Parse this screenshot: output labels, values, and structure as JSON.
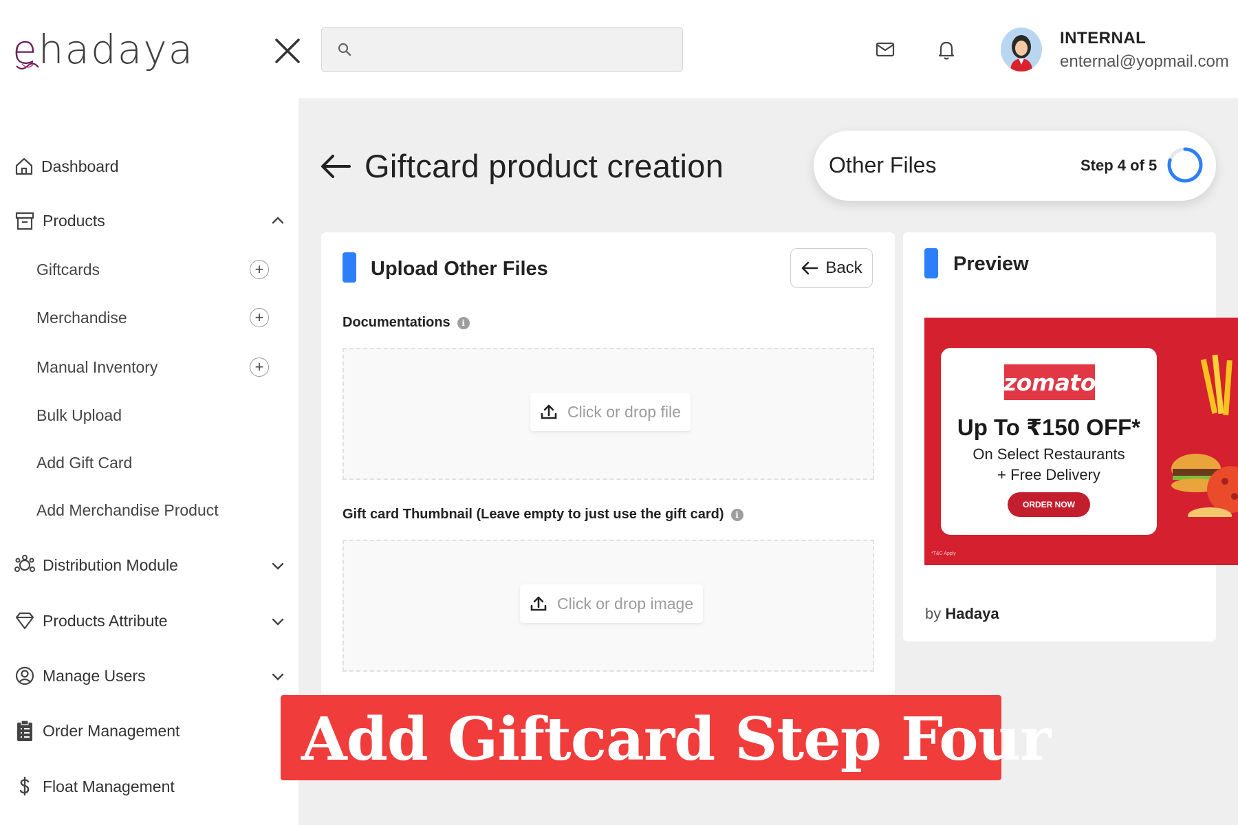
{
  "header": {
    "logo_text": "ehadaya",
    "search": {
      "placeholder": ""
    },
    "user": {
      "name": "INTERNAL",
      "email": "enternal@yopmail.com"
    }
  },
  "sidebar": {
    "items": [
      {
        "label": "Dashboard",
        "icon": "home-icon"
      },
      {
        "label": "Products",
        "icon": "archive-box-icon",
        "expanded": true,
        "children": [
          {
            "label": "Giftcards",
            "has_add": true
          },
          {
            "label": "Merchandise",
            "has_add": true
          },
          {
            "label": "Manual Inventory",
            "has_add": true
          },
          {
            "label": "Bulk Upload",
            "has_add": false
          },
          {
            "label": "Add Gift Card",
            "has_add": false
          },
          {
            "label": "Add Merchandise Product",
            "has_add": false
          }
        ]
      },
      {
        "label": "Distribution Module",
        "icon": "network-icon",
        "expanded": false
      },
      {
        "label": "Products Attribute",
        "icon": "diamond-icon",
        "expanded": false
      },
      {
        "label": "Manage Users",
        "icon": "user-circle-icon",
        "expanded": false
      },
      {
        "label": "Order Management",
        "icon": "clipboard-list-icon"
      },
      {
        "label": "Float Management",
        "icon": "dollar-icon"
      }
    ]
  },
  "main": {
    "page_title": "Giftcard product creation",
    "stepper": {
      "step_name": "Other Files",
      "step_text": "Step 4 of 5",
      "progress": 0.8
    },
    "upload_card": {
      "title": "Upload Other Files",
      "back_label": "Back",
      "fields": [
        {
          "label": "Documentations",
          "drop_label": "Click or drop file"
        },
        {
          "label": "Gift card Thumbnail (Leave empty to just use the gift card)",
          "drop_label": "Click or drop image"
        }
      ]
    },
    "preview_card": {
      "title": "Preview",
      "promo": {
        "brand": "zomato",
        "offer": "Up To ₹150 OFF*",
        "line1": "On Select Restaurants",
        "line2": "+ Free Delivery",
        "cta": "ORDER NOW",
        "terms": "*T&C Apply"
      },
      "by_prefix": "by",
      "by_name": "Hadaya"
    }
  },
  "overlay": {
    "text": "Add Giftcard Step Four"
  },
  "colors": {
    "accent": "#2d7ff9",
    "brand": "#6a1f57",
    "banner": "#f13c3c",
    "promo_bg": "#d4202f"
  }
}
